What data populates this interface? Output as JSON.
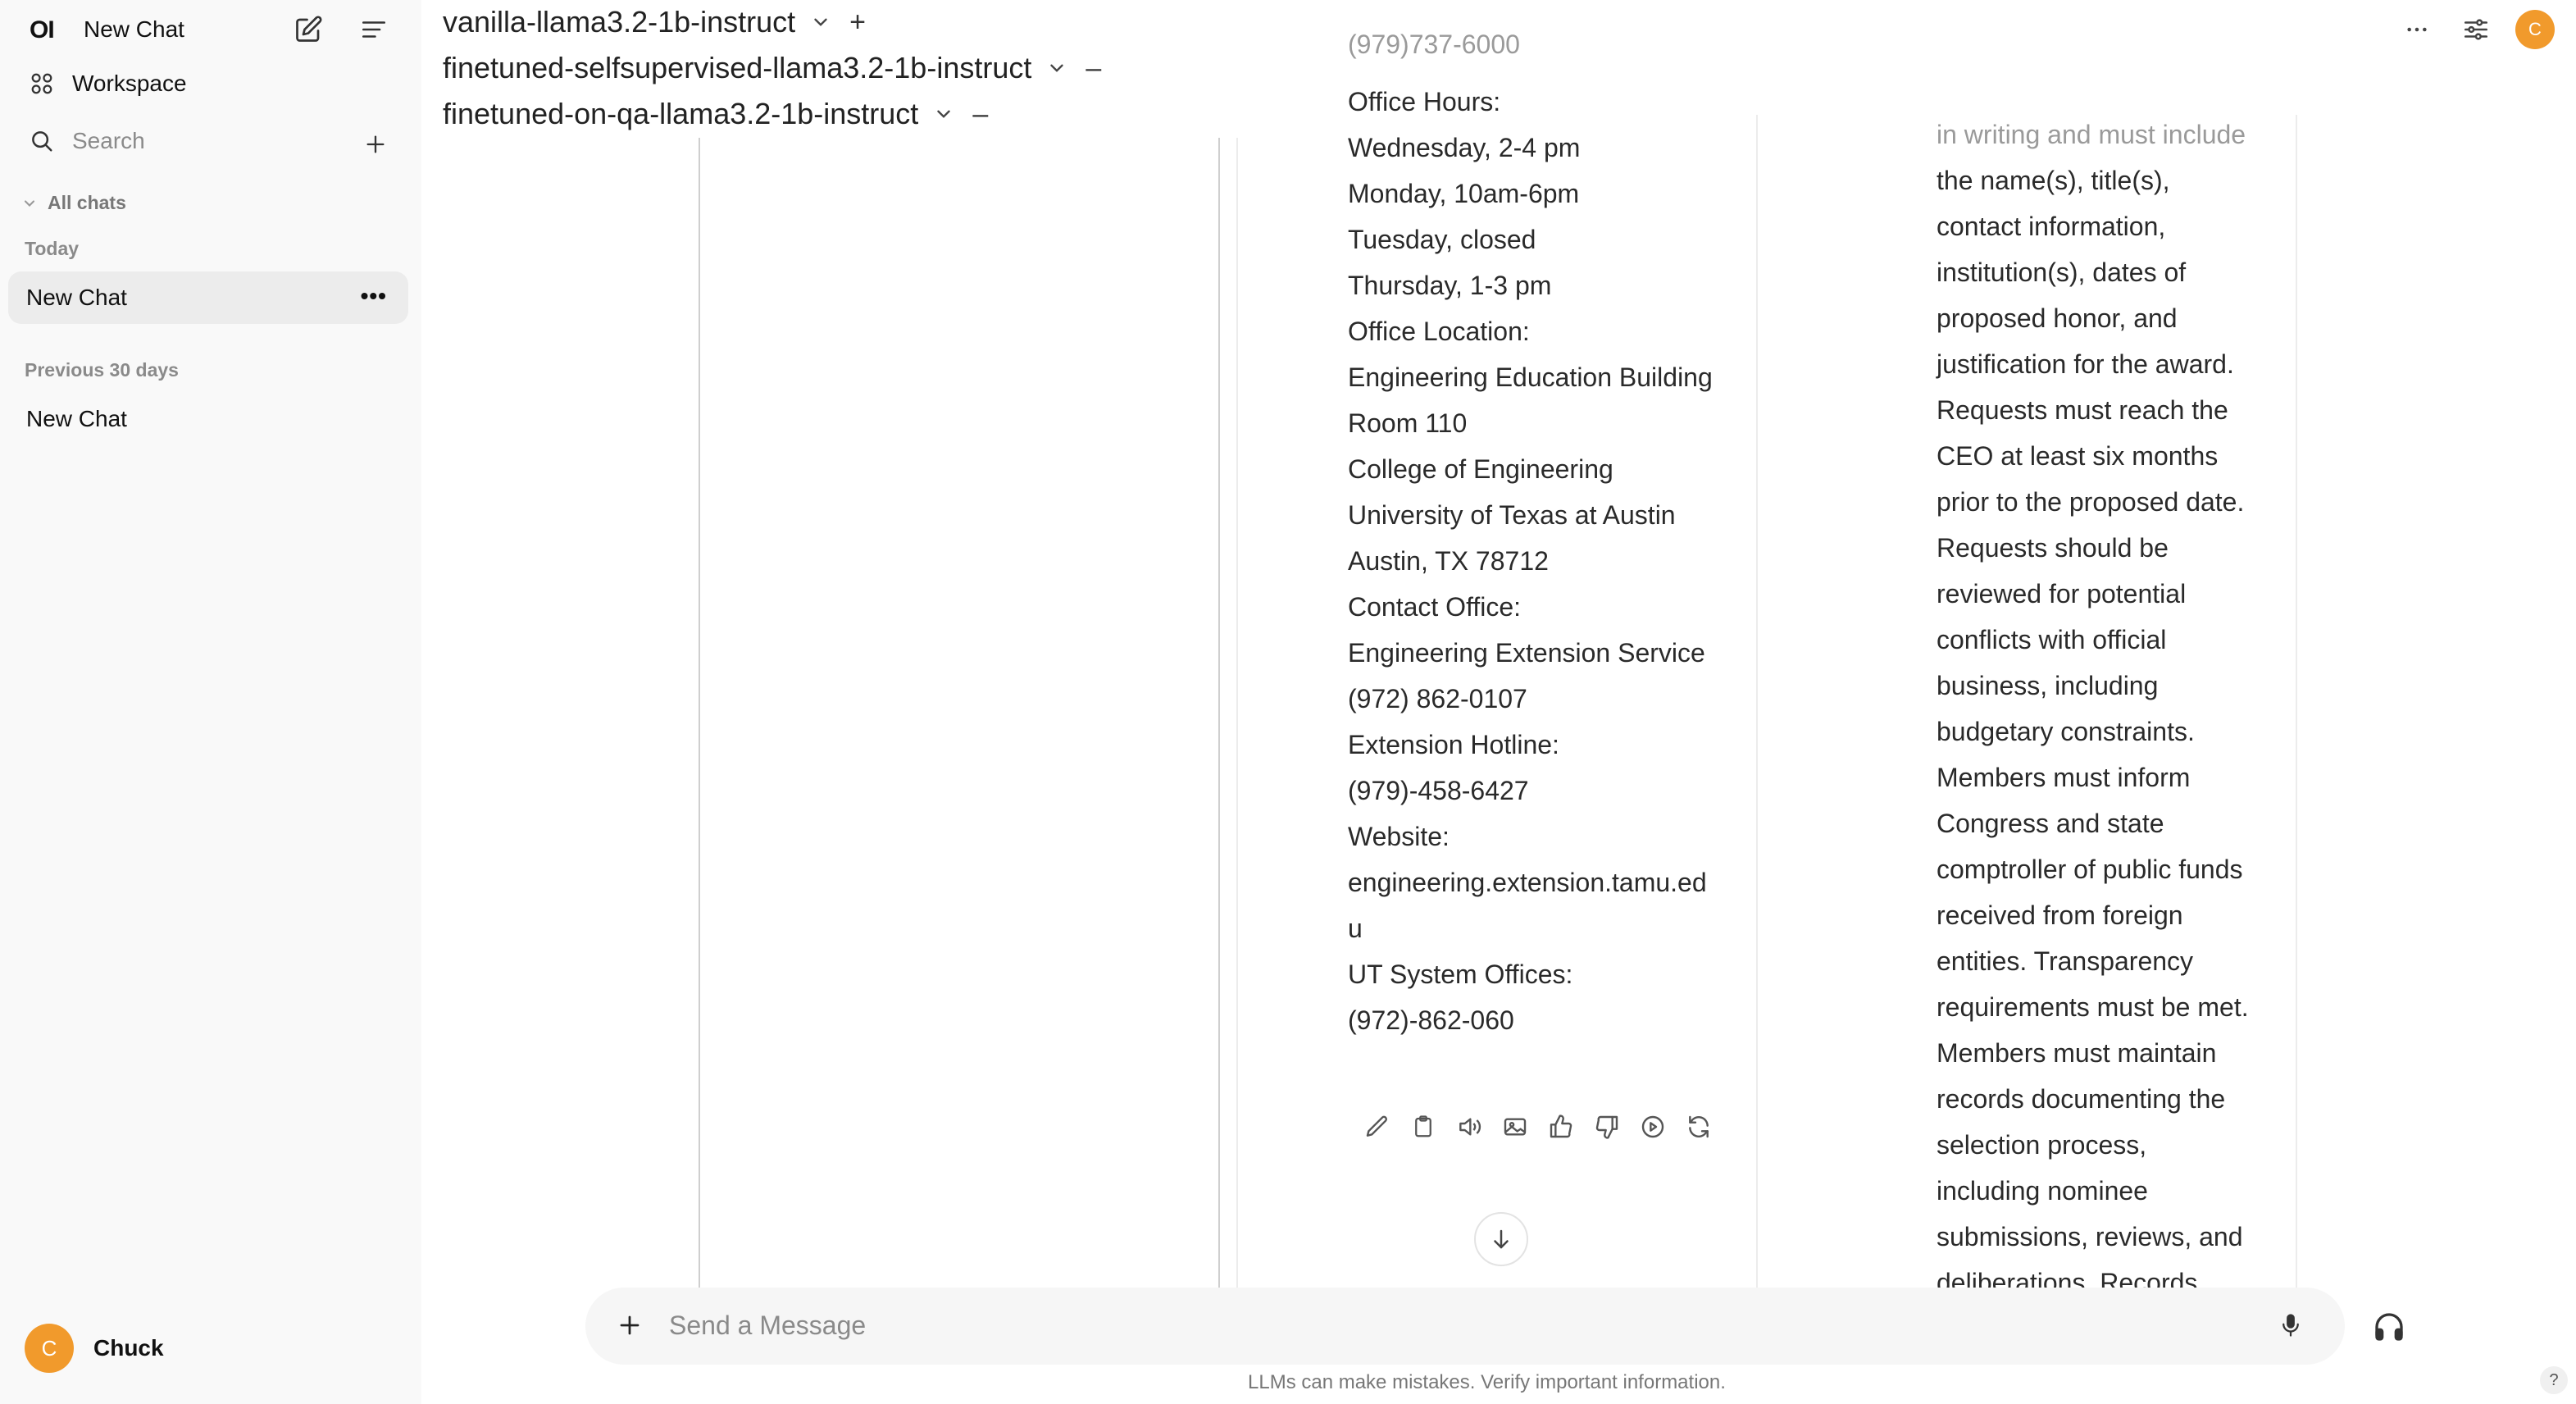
{
  "app": {
    "logo": "OI",
    "title": "New Chat"
  },
  "sidebar": {
    "workspace_label": "Workspace",
    "search_placeholder": "Search",
    "all_chats_label": "All chats",
    "sections": [
      {
        "title": "Today",
        "items": [
          {
            "label": "New Chat",
            "active": true
          }
        ]
      },
      {
        "title": "Previous 30 days",
        "items": [
          {
            "label": "New Chat",
            "active": false
          }
        ]
      }
    ],
    "user": {
      "initial": "C",
      "name": "Chuck"
    }
  },
  "header": {
    "models": [
      {
        "name": "vanilla-llama3.2-1b-instruct",
        "action": "+"
      },
      {
        "name": "finetuned-selfsupervised-llama3.2-1b-instruct",
        "action": "–"
      },
      {
        "name": "finetuned-on-qa-llama3.2-1b-instruct",
        "action": "–"
      }
    ],
    "user_initial": "C"
  },
  "columns": {
    "middle": {
      "faded_top": "(979)737-6000",
      "lines": [
        "Office Hours:",
        "Wednesday, 2-4 pm",
        "Monday, 10am-6pm",
        "Tuesday, closed",
        "Thursday, 1-3 pm",
        "Office Location:",
        "Engineering Education Building",
        "Room 110",
        "College of Engineering",
        "University of Texas at Austin",
        "Austin, TX 78712",
        "Contact Office:",
        "Engineering Extension Service",
        "(972) 862-0107",
        "Extension Hotline:",
        "(979)-458-6427",
        "Website:",
        "engineering.extension.tamu.ed",
        "u",
        "UT System Offices:",
        "(972)-862-060"
      ]
    },
    "right": {
      "faded_top": "in writing and must include",
      "lines": [
        "the name(s), title(s),",
        "contact information,",
        "institution(s), dates of",
        "proposed honor, and",
        "justification for the award.",
        "Requests must reach the",
        "CEO at least six months",
        "prior to the proposed date.",
        "Requests should be",
        "reviewed for potential",
        "conflicts with official",
        "business, including",
        "budgetary constraints.",
        "Members must inform",
        "Congress and state",
        "comptroller of public funds",
        "received from foreign",
        "entities. Transparency",
        "requirements must be met.",
        "Members must maintain",
        "records documenting the",
        "selection process,",
        "including nominee",
        "submissions, reviews, and",
        "deliberations. Records"
      ]
    }
  },
  "message_actions": [
    "edit-icon",
    "copy-icon",
    "speaker-icon",
    "image-icon",
    "thumbs-up-icon",
    "thumbs-down-icon",
    "play-icon",
    "regenerate-icon"
  ],
  "composer": {
    "placeholder": "Send a Message"
  },
  "footer": {
    "disclaimer": "LLMs can make mistakes. Verify important information.",
    "help": "?"
  }
}
